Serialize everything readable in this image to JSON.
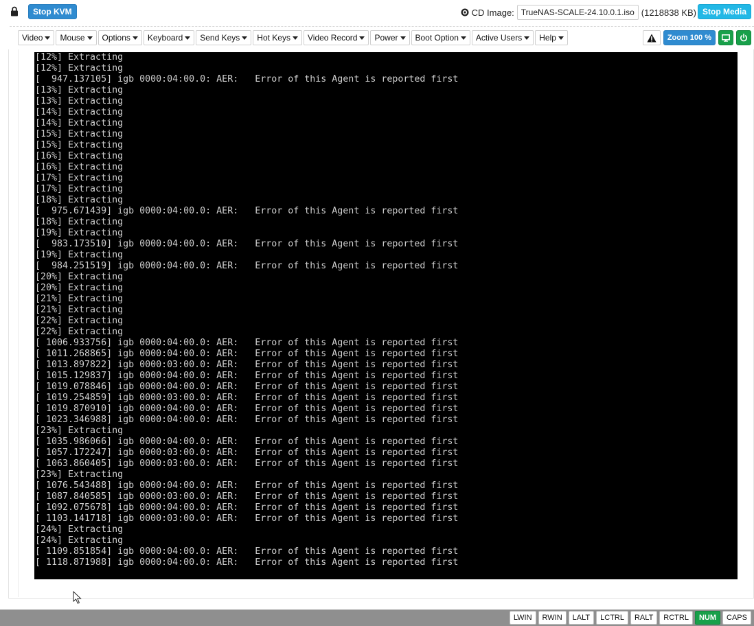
{
  "toolbar": {
    "stop_kvm_label": "Stop KVM",
    "cd_image_label": "CD Image:",
    "cd_image_file": "TrueNAS-SCALE-24.10.0.1.iso",
    "cd_image_size": "(1218838 KB)",
    "stop_media_label": "Stop Media"
  },
  "menu": [
    {
      "label": "Video"
    },
    {
      "label": "Mouse"
    },
    {
      "label": "Options"
    },
    {
      "label": "Keyboard"
    },
    {
      "label": "Send Keys"
    },
    {
      "label": "Hot Keys"
    },
    {
      "label": "Video Record"
    },
    {
      "label": "Power"
    },
    {
      "label": "Boot Option"
    },
    {
      "label": "Active Users"
    },
    {
      "label": "Help"
    }
  ],
  "tools": {
    "zoom_label": "Zoom 100 %"
  },
  "console_lines": [
    "[12%] Extracting",
    "[12%] Extracting",
    "[  947.137105] igb 0000:04:00.0: AER:   Error of this Agent is reported first",
    "[13%] Extracting",
    "[13%] Extracting",
    "[14%] Extracting",
    "[14%] Extracting",
    "[15%] Extracting",
    "[15%] Extracting",
    "[16%] Extracting",
    "[16%] Extracting",
    "[17%] Extracting",
    "[17%] Extracting",
    "[18%] Extracting",
    "[  975.671439] igb 0000:04:00.0: AER:   Error of this Agent is reported first",
    "[18%] Extracting",
    "[19%] Extracting",
    "[  983.173510] igb 0000:04:00.0: AER:   Error of this Agent is reported first",
    "[19%] Extracting",
    "[  984.251519] igb 0000:04:00.0: AER:   Error of this Agent is reported first",
    "[20%] Extracting",
    "[20%] Extracting",
    "[21%] Extracting",
    "[21%] Extracting",
    "[22%] Extracting",
    "[22%] Extracting",
    "[ 1006.933756] igb 0000:04:00.0: AER:   Error of this Agent is reported first",
    "[ 1011.268865] igb 0000:04:00.0: AER:   Error of this Agent is reported first",
    "[ 1013.897822] igb 0000:03:00.0: AER:   Error of this Agent is reported first",
    "[ 1015.129837] igb 0000:04:00.0: AER:   Error of this Agent is reported first",
    "[ 1019.078846] igb 0000:04:00.0: AER:   Error of this Agent is reported first",
    "[ 1019.254859] igb 0000:03:00.0: AER:   Error of this Agent is reported first",
    "[ 1019.870910] igb 0000:04:00.0: AER:   Error of this Agent is reported first",
    "[ 1023.346988] igb 0000:04:00.0: AER:   Error of this Agent is reported first",
    "[23%] Extracting",
    "[ 1035.986066] igb 0000:04:00.0: AER:   Error of this Agent is reported first",
    "[ 1057.172247] igb 0000:03:00.0: AER:   Error of this Agent is reported first",
    "[ 1063.860405] igb 0000:03:00.0: AER:   Error of this Agent is reported first",
    "[23%] Extracting",
    "[ 1076.543488] igb 0000:04:00.0: AER:   Error of this Agent is reported first",
    "[ 1087.840585] igb 0000:03:00.0: AER:   Error of this Agent is reported first",
    "[ 1092.075678] igb 0000:04:00.0: AER:   Error of this Agent is reported first",
    "[ 1103.141718] igb 0000:03:00.0: AER:   Error of this Agent is reported first",
    "[24%] Extracting",
    "[24%] Extracting",
    "[ 1109.851854] igb 0000:04:00.0: AER:   Error of this Agent is reported first",
    "[ 1118.871988] igb 0000:04:00.0: AER:   Error of this Agent is reported first"
  ],
  "status_keys": [
    {
      "label": "LWIN",
      "active": false
    },
    {
      "label": "RWIN",
      "active": false
    },
    {
      "label": "LALT",
      "active": false
    },
    {
      "label": "LCTRL",
      "active": false
    },
    {
      "label": "RALT",
      "active": false
    },
    {
      "label": "RCTRL",
      "active": false
    },
    {
      "label": "NUM",
      "active": true
    },
    {
      "label": "CAPS",
      "active": false
    }
  ],
  "colors": {
    "primary_blue": "#2f8bd0",
    "media_cyan": "#22b8e6",
    "power_green": "#18a04a",
    "console_bg": "#000000",
    "console_text": "#cfcfcf",
    "statusbar_bg": "#8f8f8f"
  },
  "icons": {
    "lock": "lock-icon",
    "cd": "disc-icon",
    "warning": "warning-icon",
    "display": "monitor-icon",
    "power": "power-icon",
    "dropdown": "caret-down-icon",
    "pointer": "mouse-pointer-icon"
  }
}
